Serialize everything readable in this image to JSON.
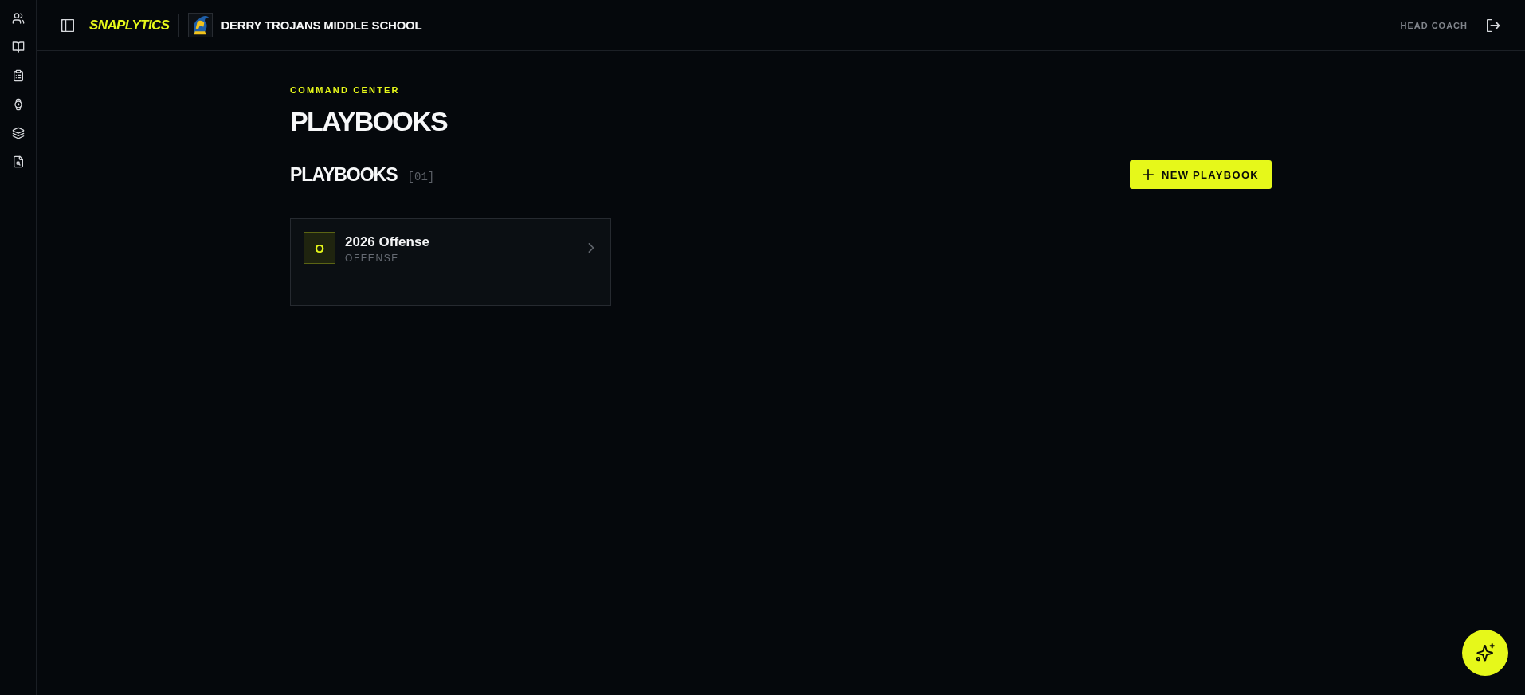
{
  "header": {
    "brand": "SNAPLYTICS",
    "school_name": "DERRY TROJANS MIDDLE SCHOOL",
    "role": "HEAD COACH"
  },
  "page": {
    "eyebrow": "COMMAND CENTER",
    "title": "PLAYBOOKS"
  },
  "section": {
    "title": "PLAYBOOKS",
    "count": "[01]",
    "new_button": "NEW PLAYBOOK"
  },
  "playbooks": [
    {
      "initial": "O",
      "name": "2026 Offense",
      "type": "OFFENSE"
    }
  ]
}
